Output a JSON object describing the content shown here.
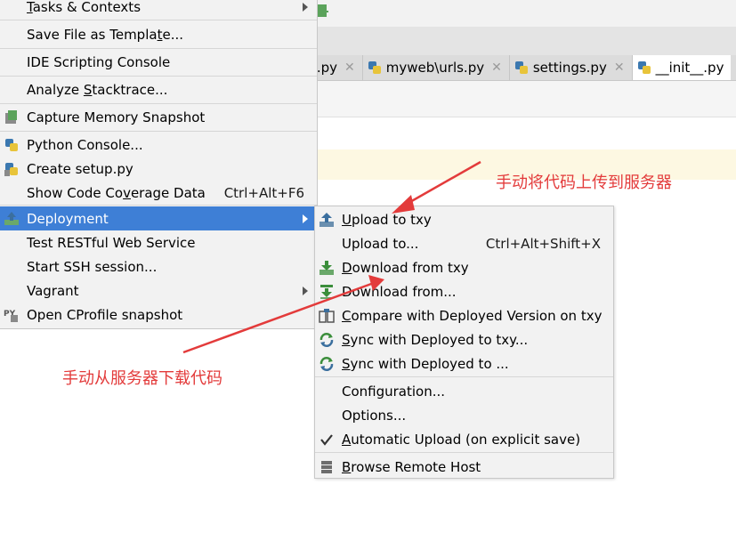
{
  "editor": {
    "tabs": [
      {
        "label": "s.py"
      },
      {
        "label": "myweb\\urls.py"
      },
      {
        "label": "settings.py"
      },
      {
        "label": "__init__.py"
      }
    ],
    "tab_close_glyph": "✕"
  },
  "main_menu": {
    "items": [
      {
        "label": "Tasks & Contexts",
        "mnemonic": "T",
        "rest": "asks & Contexts",
        "has_submenu": true
      },
      {
        "label": "Save File as Template...",
        "pre": "Save File as Templa",
        "mnemonic": "t",
        "rest": "e..."
      },
      {
        "label": "IDE Scripting Console"
      },
      {
        "label": "Analyze Stacktrace...",
        "pre": "Analyze ",
        "mnemonic": "S",
        "rest": "tacktrace..."
      },
      {
        "label": "Capture Memory Snapshot",
        "icon": "memory-snapshot-icon"
      },
      {
        "label": "Python Console...",
        "icon": "python-icon"
      },
      {
        "label": "Create setup.py",
        "icon": "python-setup-icon"
      },
      {
        "label": "Show Code Coverage Data",
        "pre": "Show Code Co",
        "mnemonic": "v",
        "rest": "erage Data",
        "shortcut": "Ctrl+Alt+F6"
      },
      {
        "label": "Deployment",
        "icon": "deployment-icon",
        "has_submenu": true,
        "selected": true
      },
      {
        "label": "Test RESTful Web Service"
      },
      {
        "label": "Start SSH session..."
      },
      {
        "label": "Vagrant",
        "has_submenu": true
      },
      {
        "label": "Open CProfile snapshot",
        "icon": "cprofile-icon"
      }
    ]
  },
  "deployment_submenu": {
    "items": [
      {
        "label": "Upload to txy",
        "mnemonic": "U",
        "rest": "pload to txy",
        "icon": "upload-icon"
      },
      {
        "label": "Upload to...",
        "shortcut": "Ctrl+Alt+Shift+X"
      },
      {
        "label": "Download from txy",
        "mnemonic": "D",
        "rest": "ownload from txy",
        "icon": "download-icon"
      },
      {
        "label": "Download from...",
        "icon": "download-from-icon"
      },
      {
        "label": "Compare with Deployed Version on txy",
        "mnemonic": "C",
        "rest": "ompare with Deployed Version on txy",
        "icon": "compare-icon"
      },
      {
        "label": "Sync with Deployed to txy...",
        "mnemonic": "S",
        "rest": "ync with Deployed to txy...",
        "icon": "sync-icon"
      },
      {
        "label": "Sync with Deployed to ...",
        "mnemonic": "S",
        "rest": "ync with Deployed to ...",
        "icon": "sync-icon"
      },
      {
        "label": "Configuration..."
      },
      {
        "label": "Options..."
      },
      {
        "label": "Automatic Upload (on explicit save)",
        "mnemonic": "A",
        "rest": "utomatic Upload (on explicit save)",
        "checked": true
      },
      {
        "label": "Browse Remote Host",
        "mnemonic": "B",
        "rest": "rowse Remote Host",
        "icon": "server-icon"
      }
    ]
  },
  "annotations": {
    "upload_note": "手动将代码上传到服务器",
    "download_note": "手动从服务器下载代码"
  },
  "colors": {
    "menu_bg": "#f2f2f2",
    "selection": "#3e7fd6",
    "annotation": "#e33b3b"
  }
}
